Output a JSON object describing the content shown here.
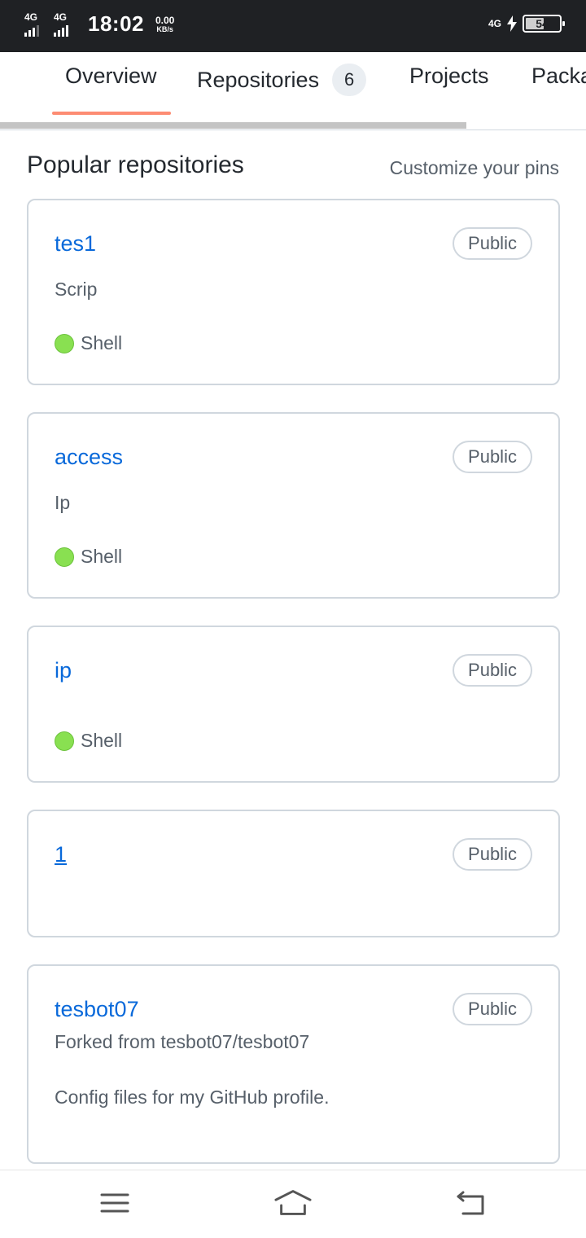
{
  "status_bar": {
    "sim1": "4G",
    "sim2": "4G",
    "time": "18:02",
    "speed_value": "0.00",
    "speed_unit": "KB/s",
    "network": "4G",
    "battery": "54"
  },
  "tabs": [
    {
      "label": "Overview",
      "active": true
    },
    {
      "label": "Repositories",
      "count": "6"
    },
    {
      "label": "Projects"
    },
    {
      "label": "Packa"
    }
  ],
  "section": {
    "title": "Popular repositories",
    "customize_link": "Customize your pins"
  },
  "repos": [
    {
      "name": "tes1",
      "visibility": "Public",
      "description": "Scrip",
      "language": "Shell"
    },
    {
      "name": "access",
      "visibility": "Public",
      "description": "Ip",
      "language": "Shell"
    },
    {
      "name": "ip",
      "visibility": "Public",
      "language": "Shell"
    },
    {
      "name": "1",
      "visibility": "Public"
    },
    {
      "name": "tesbot07",
      "visibility": "Public",
      "forked_from": "Forked from tesbot07/tesbot07",
      "description": "Config files for my GitHub profile."
    }
  ],
  "colors": {
    "link": "#0969da",
    "shell_language": "#89e051",
    "active_tab_underline": "#fd8c73"
  },
  "nav_icons": [
    "menu-icon",
    "home-icon",
    "back-icon"
  ]
}
